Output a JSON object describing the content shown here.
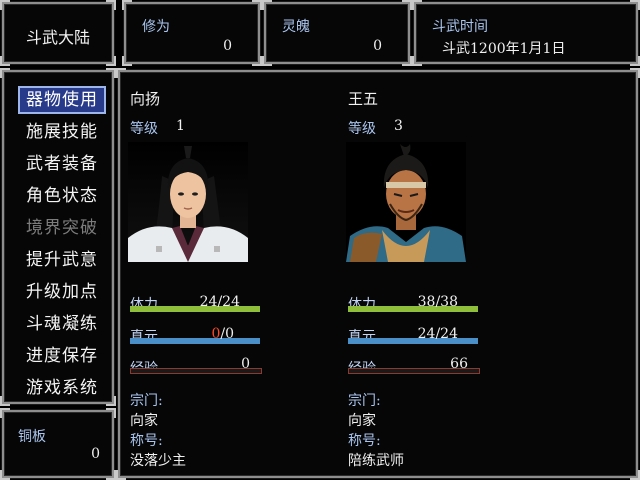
{
  "header": {
    "title": "斗武大陆",
    "cultivation": {
      "label": "修为",
      "value": "0"
    },
    "soul": {
      "label": "灵魄",
      "value": "0"
    },
    "time": {
      "label": "斗武时间",
      "value": "斗武1200年1月1日"
    }
  },
  "menu": {
    "items": [
      {
        "label": "器物使用",
        "state": "active"
      },
      {
        "label": "施展技能",
        "state": "normal"
      },
      {
        "label": "武者装备",
        "state": "normal"
      },
      {
        "label": "角色状态",
        "state": "normal"
      },
      {
        "label": "境界突破",
        "state": "disabled"
      },
      {
        "label": "提升武意",
        "state": "normal"
      },
      {
        "label": "升级加点",
        "state": "normal"
      },
      {
        "label": "斗魂凝练",
        "state": "normal"
      },
      {
        "label": "进度保存",
        "state": "normal"
      },
      {
        "label": "游戏系统",
        "state": "normal"
      }
    ]
  },
  "money": {
    "label": "铜板",
    "value": "0"
  },
  "characters": [
    {
      "name": "向扬",
      "level_label": "等级",
      "level": "1",
      "hp": {
        "label": "体力",
        "current": "24",
        "max": "24",
        "fraction": 1.0,
        "color": "#8fbf3a"
      },
      "mp": {
        "label": "真元",
        "current": "0",
        "max": "0",
        "fraction": 1.0,
        "color": "#4a8fc8"
      },
      "exp": {
        "label": "经验",
        "value": "0",
        "fraction": 0.0,
        "color": "#b03a2a"
      },
      "sect_label": "宗门:",
      "sect": "向家",
      "title_label": "称号:",
      "title": "没落少主"
    },
    {
      "name": "王五",
      "level_label": "等级",
      "level": "3",
      "hp": {
        "label": "体力",
        "current": "38",
        "max": "38",
        "fraction": 1.0,
        "color": "#8fbf3a"
      },
      "mp": {
        "label": "真元",
        "current": "24",
        "max": "24",
        "fraction": 1.0,
        "color": "#4a8fc8"
      },
      "exp": {
        "label": "经验",
        "value": "66",
        "fraction": 0.0,
        "color": "#b03a2a"
      },
      "sect_label": "宗门:",
      "sect": "向家",
      "title_label": "称号:",
      "title": "陪练武师"
    }
  ]
}
